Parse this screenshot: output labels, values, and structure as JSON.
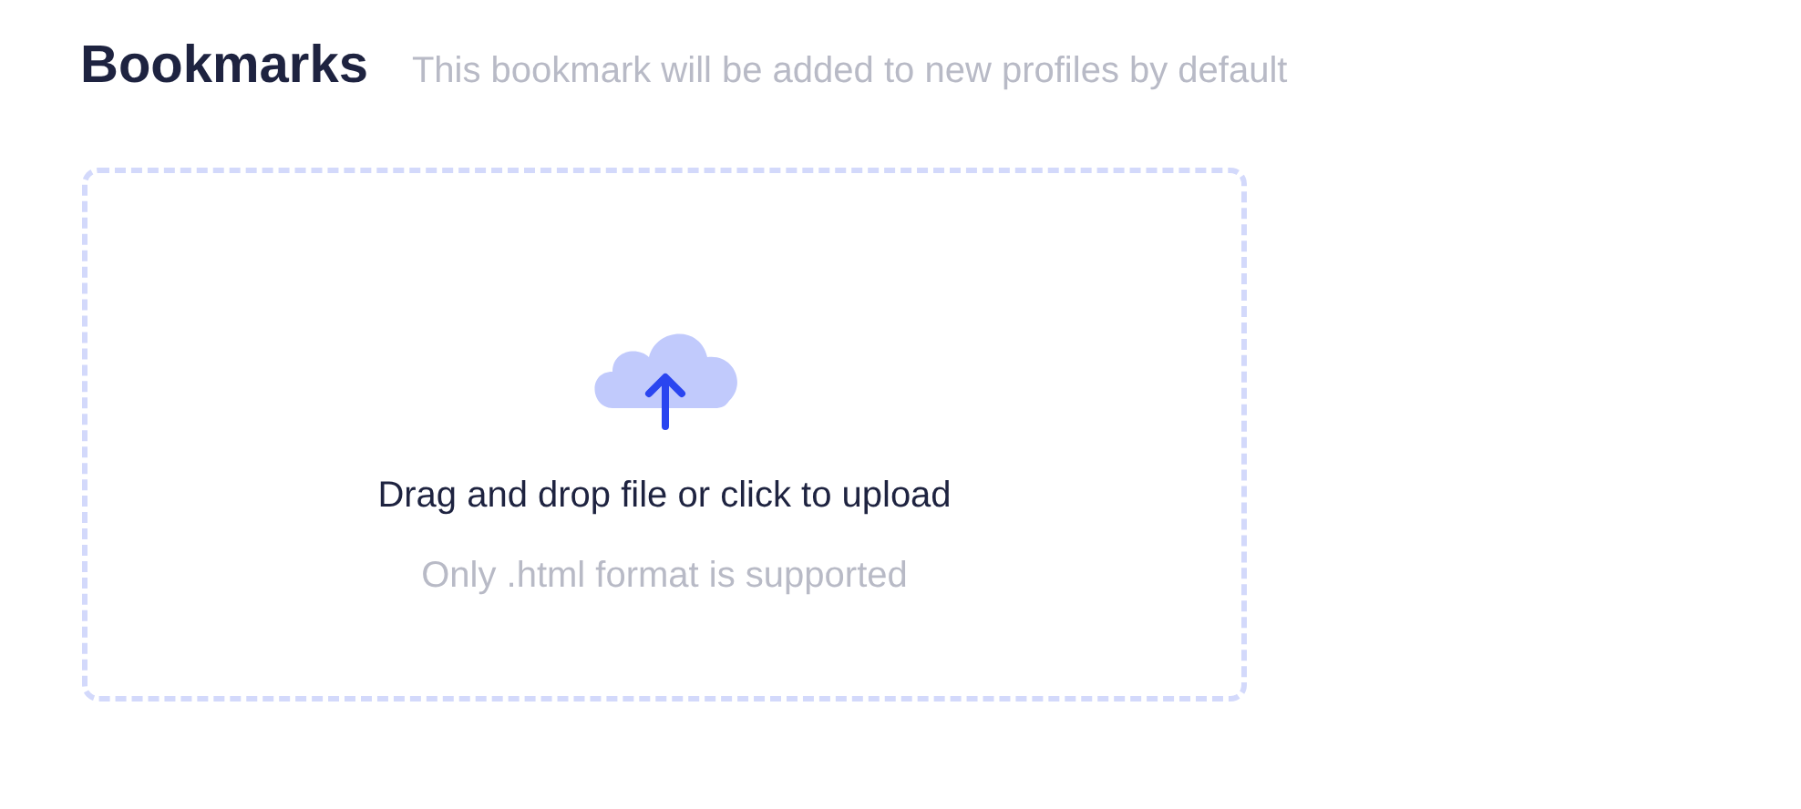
{
  "header": {
    "title": "Bookmarks",
    "subtitle": "This bookmark will be added to new profiles by default"
  },
  "upload": {
    "instruction": "Drag and drop file or click to upload",
    "hint": "Only .html format is supported"
  }
}
